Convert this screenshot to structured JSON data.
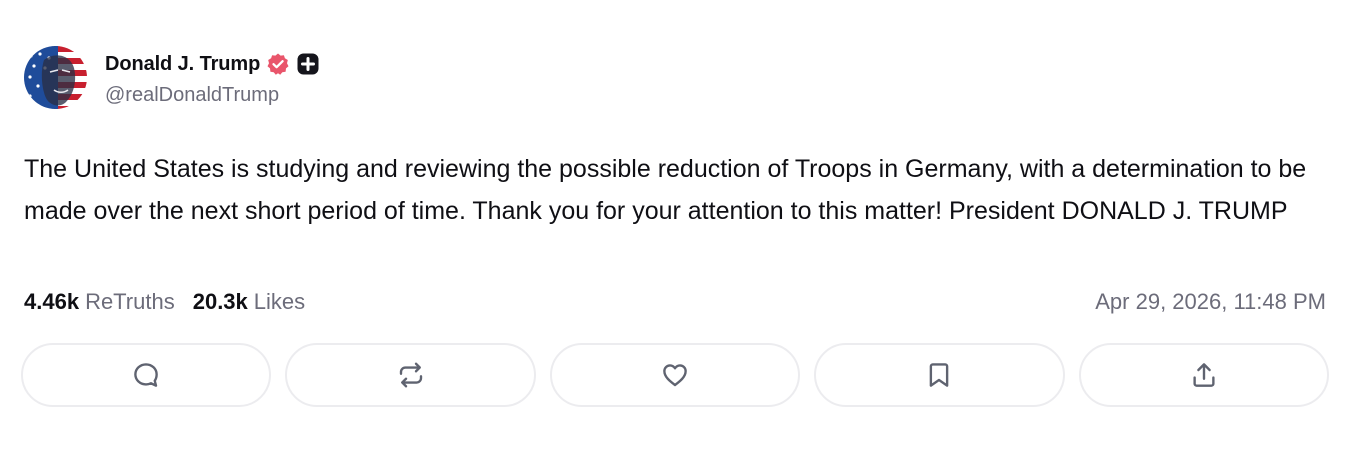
{
  "author": {
    "name": "Donald J. Trump",
    "handle": "@realDonaldTrump",
    "verified_color": "#e9556b"
  },
  "post": {
    "text": "The United States is studying and reviewing the possible reduction of Troops in Germany, with a determination to be made over the next short period of time. Thank you for your attention to this matter! President DONALD J. TRUMP",
    "timestamp": "Apr 29, 2026, 11:48 PM"
  },
  "stats": {
    "retruths_count": "4.46k",
    "retruths_label": "ReTruths",
    "likes_count": "20.3k",
    "likes_label": "Likes"
  },
  "actions": [
    {
      "icon": "reply-icon"
    },
    {
      "icon": "retruth-icon"
    },
    {
      "icon": "heart-icon"
    },
    {
      "icon": "bookmark-icon"
    },
    {
      "icon": "share-icon"
    }
  ],
  "colors": {
    "text": "#0f0f14",
    "muted": "#6c6c7a",
    "border": "#ececef",
    "icon": "#5f6370"
  }
}
